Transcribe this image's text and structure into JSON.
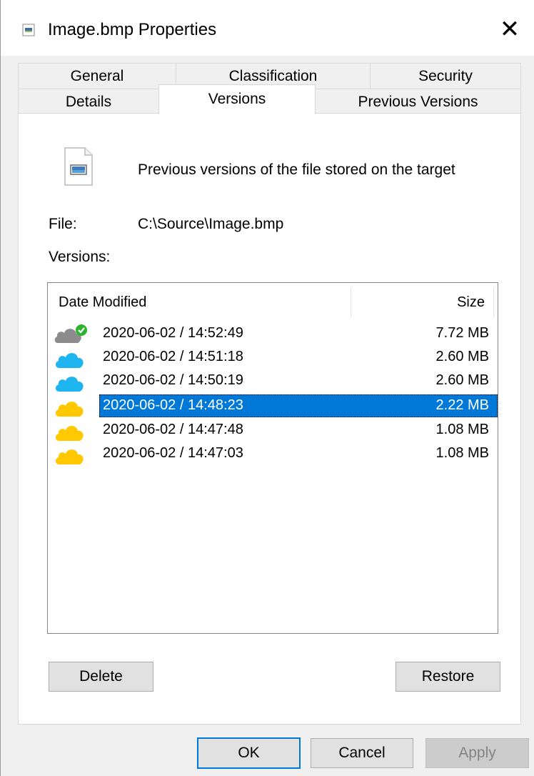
{
  "window": {
    "title": "Image.bmp Properties",
    "close_glyph": "✕"
  },
  "tabs": {
    "row1": [
      {
        "label": "General"
      },
      {
        "label": "Classification"
      },
      {
        "label": "Security"
      }
    ],
    "row2": [
      {
        "label": "Details"
      },
      {
        "label": "Versions",
        "active": true
      },
      {
        "label": "Previous Versions"
      }
    ]
  },
  "versions_panel": {
    "description": "Previous versions of the file stored on the target",
    "file_label": "File:",
    "file_path": "C:\\Source\\Image.bmp",
    "versions_label": "Versions:",
    "columns": {
      "date": "Date Modified",
      "size": "Size"
    },
    "rows": [
      {
        "date": "2020-06-02 / 14:52:49",
        "size": "7.72 MB",
        "icon": "cloud-gray-check-icon"
      },
      {
        "date": "2020-06-02 / 14:51:18",
        "size": "2.60 MB",
        "icon": "cloud-blue-icon"
      },
      {
        "date": "2020-06-02 / 14:50:19",
        "size": "2.60 MB",
        "icon": "cloud-blue-icon"
      },
      {
        "date": "2020-06-02 / 14:48:23",
        "size": "2.22 MB",
        "icon": "cloud-yellow-icon",
        "selected": true
      },
      {
        "date": "2020-06-02 / 14:47:48",
        "size": "1.08 MB",
        "icon": "cloud-yellow-icon"
      },
      {
        "date": "2020-06-02 / 14:47:03",
        "size": "1.08 MB",
        "icon": "cloud-yellow-icon"
      }
    ],
    "delete_label": "Delete",
    "restore_label": "Restore"
  },
  "footer": {
    "ok_label": "OK",
    "cancel_label": "Cancel",
    "apply_label": "Apply"
  },
  "colors": {
    "selection": "#0078d7",
    "cloud_blue": "#1eb4f0",
    "cloud_yellow": "#ffc800",
    "cloud_gray": "#8c8c8c",
    "check_green": "#2db32d"
  }
}
